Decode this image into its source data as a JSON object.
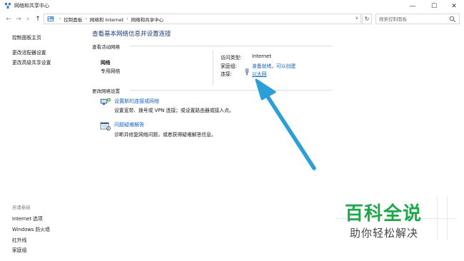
{
  "window": {
    "title": "网络和共享中心",
    "minimize_glyph": "—",
    "maximize_glyph": "☐",
    "close_glyph": "✕"
  },
  "nav": {
    "back_glyph": "←",
    "forward_glyph": "→",
    "recent_glyph": "∨",
    "up_glyph": "↑",
    "breadcrumb": [
      "控制面板",
      "网络和 Internet",
      "网络和共享中心"
    ],
    "separator": "›",
    "dropdown_glyph": "∨",
    "refresh_glyph": "↻",
    "search_placeholder": "搜索控制面板"
  },
  "sidebar": {
    "items": [
      "控制面板主页",
      "更改适配器设置",
      "更改高级共享设置"
    ],
    "see_also_heading": "另请参阅",
    "see_also": [
      "Internet 选项",
      "Windows 防火墙",
      "红外线",
      "家庭组"
    ]
  },
  "main": {
    "title": "查看基本网络信息并设置连接",
    "active_networks_heading": "查看活动网络",
    "network_name": "网络",
    "network_type": "专用网络",
    "access_type_label": "访问类型:",
    "access_type_value": "Internet",
    "homegroup_label": "家庭组:",
    "homegroup_value": "准备就绪，可以创建",
    "connections_label": "连接:",
    "connections_value": "以太网",
    "change_settings_heading": "更改网络设置",
    "tasks": [
      {
        "link": "设置新的连接或网络",
        "desc": "设置宽带、拨号或 VPN 连接；或设置路由器或接入点。"
      },
      {
        "link": "问题疑难解答",
        "desc": "诊断并修复网络问题，或者获得疑难解答信息。"
      }
    ]
  },
  "watermark": {
    "big": "百科全说",
    "small": "助你轻松解决"
  },
  "colors": {
    "link": "#1565c0",
    "title": "#1e3b72",
    "arrow": "#2d9fd8",
    "watermark_green": "#1ea84a"
  },
  "icons": {
    "title_icon": "network-center-icon",
    "addr_icon": "control-panel-icon",
    "search": "search-icon",
    "ethernet": "ethernet-icon",
    "new_connection": "new-connection-icon",
    "troubleshoot": "troubleshoot-icon"
  }
}
